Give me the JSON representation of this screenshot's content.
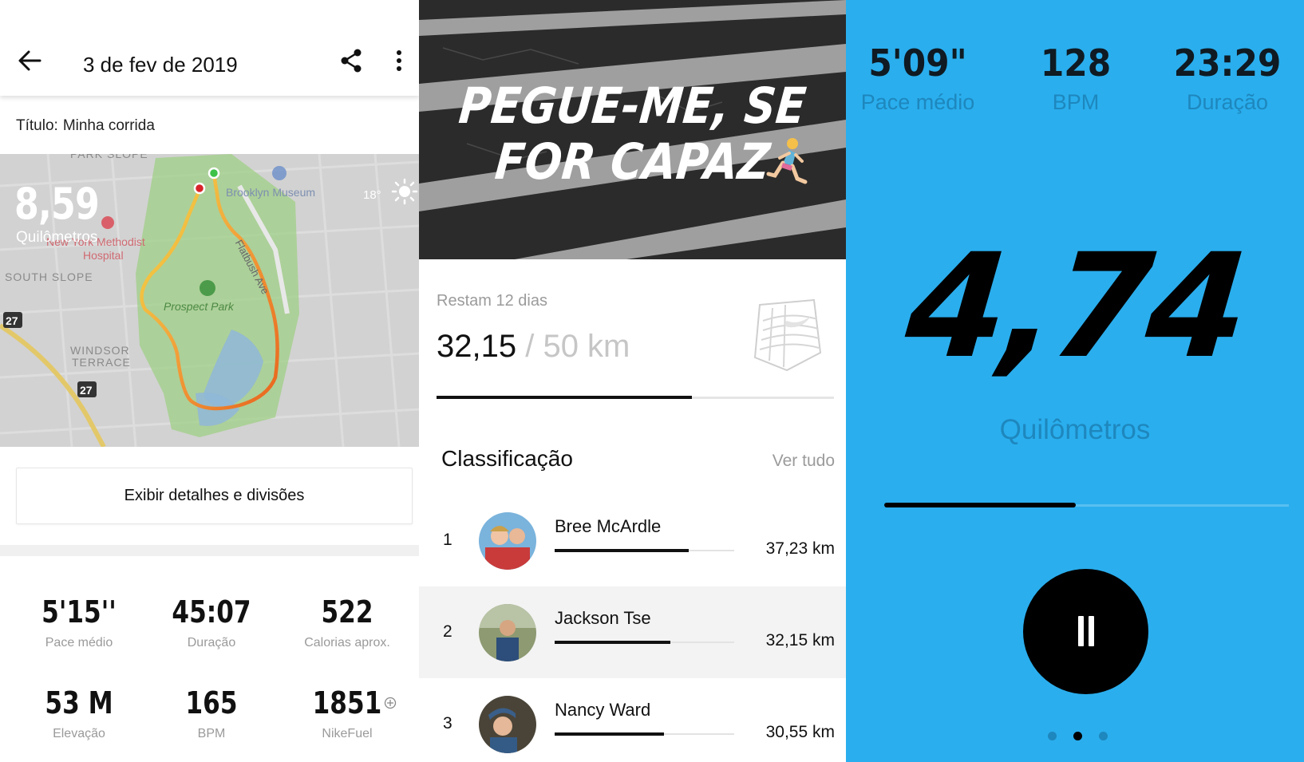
{
  "activity": {
    "date": "3 de fev de 2019",
    "title_label": "Título:",
    "title_value": "Minha corrida",
    "map": {
      "distance": "8,59",
      "distance_unit": "Quilômetros",
      "temperature": "18°",
      "labels": {
        "park_slope": "PARK SLOPE",
        "brooklyn_museum": "Brooklyn Museum",
        "flatbush": "Flatbush Ave",
        "hospital_1": "New York Methodist",
        "hospital_2": "Hospital",
        "south_slope": "SOUTH SLOPE",
        "prospect_park": "Prospect Park",
        "windsor_1": "WINDSOR",
        "windsor_2": "TERRACE",
        "route_27a": "27",
        "route_27b": "27"
      }
    },
    "details_button": "Exibir detalhes e divisões",
    "stats": [
      {
        "value": "5'15''",
        "label": "Pace médio"
      },
      {
        "value": "45:07",
        "label": "Duração"
      },
      {
        "value": "522",
        "label": "Calorias aprox."
      },
      {
        "value": "53 M",
        "label": "Elevação"
      },
      {
        "value": "165",
        "label": "BPM"
      },
      {
        "value": "1851",
        "label": "NikeFuel"
      }
    ]
  },
  "challenge": {
    "hero_line1": "PEGUE-ME, SE",
    "hero_line2": "FOR CAPAZ",
    "days_left": "Restam 12 dias",
    "current": "32,15",
    "goal": " / 50 km",
    "progress_fraction": 0.643,
    "leaderboard_title": "Classificação",
    "see_all": "Ver tudo",
    "leaders": [
      {
        "rank": "1",
        "name": "Bree McArdle",
        "distance": "37,23 km",
        "fraction": 0.745
      },
      {
        "rank": "2",
        "name": "Jackson Tse",
        "distance": "32,15 km",
        "fraction": 0.643
      },
      {
        "rank": "3",
        "name": "Nancy Ward",
        "distance": "30,55 km",
        "fraction": 0.611
      }
    ]
  },
  "run": {
    "stats": [
      {
        "value": "5'09\"",
        "label": "Pace médio"
      },
      {
        "value": "128",
        "label": "BPM"
      },
      {
        "value": "23:29",
        "label": "Duração"
      }
    ],
    "distance": "4,74",
    "distance_unit": "Quilômetros",
    "progress_fraction": 0.474,
    "page_indicator": {
      "count": 3,
      "active": 2
    }
  },
  "colors": {
    "run_background": "#2aaeee",
    "run_label": "#1e87bd",
    "route_start": "#f2e24a",
    "route_end": "#e8641e",
    "park_green": "#9fcf86"
  }
}
